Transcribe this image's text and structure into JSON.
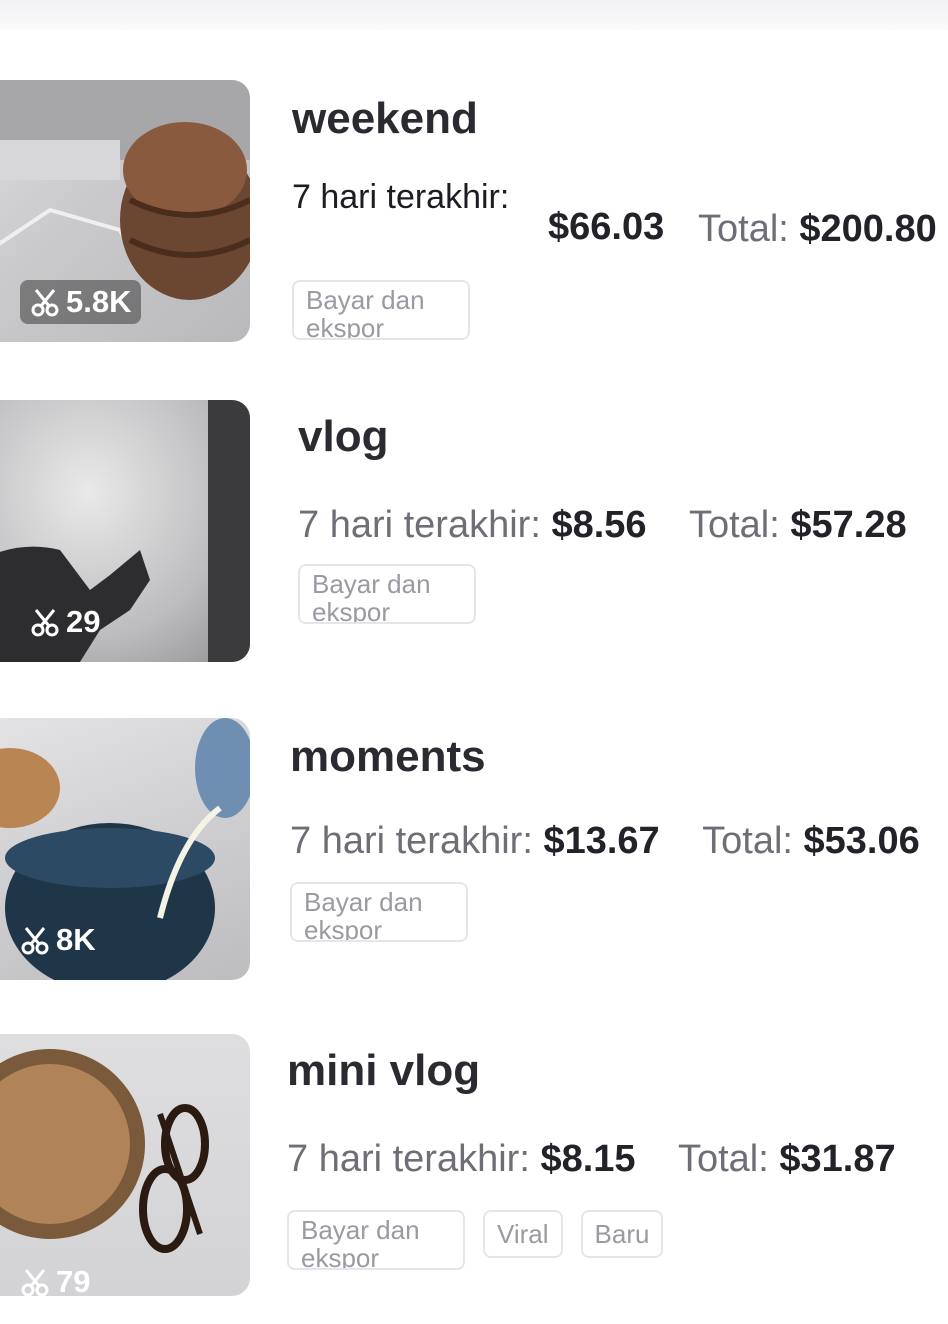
{
  "items": [
    {
      "title": "weekend",
      "last7_label": "7 hari terakhir:",
      "last7_value": "$66.03",
      "total_label": "Total:",
      "total_value": "$200.80",
      "uses": "5.8K",
      "tags": [
        "Bayar dan ekspor"
      ]
    },
    {
      "title": "vlog",
      "last7_label": "7 hari terakhir:",
      "last7_value": "$8.56",
      "total_label": "Total:",
      "total_value": "$57.28",
      "uses": "29",
      "tags": [
        "Bayar dan ekspor"
      ]
    },
    {
      "title": "moments",
      "last7_label": "7 hari terakhir:",
      "last7_value": "$13.67",
      "total_label": "Total:",
      "total_value": "$53.06",
      "uses": "8K",
      "tags": [
        "Bayar dan ekspor"
      ]
    },
    {
      "title": "mini vlog",
      "last7_label": "7 hari terakhir:",
      "last7_value": "$8.15",
      "total_label": "Total:",
      "total_value": "$31.87",
      "uses": "79",
      "tags": [
        "Bayar dan ekspor",
        "Viral",
        "Baru"
      ]
    }
  ]
}
